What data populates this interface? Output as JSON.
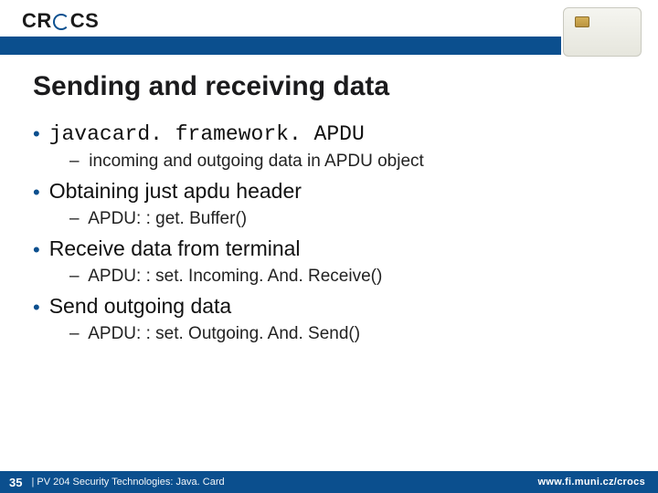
{
  "header": {
    "logo_text_left": "CR",
    "logo_text_right": "CS"
  },
  "slide": {
    "title": "Sending and receiving data",
    "b1_text": "javacard. framework. APDU",
    "b1_sub": "incoming and outgoing data in APDU object",
    "b2_text": "Obtaining just apdu header",
    "b2_sub": "APDU: : get. Buffer()",
    "b3_text": "Receive data from terminal",
    "b3_sub": "APDU: : set. Incoming. And. Receive()",
    "b4_text": "Send outgoing data",
    "b4_sub": "APDU: : set. Outgoing. And. Send()"
  },
  "footer": {
    "page": "35",
    "course": "| PV 204 Security Technologies: Java. Card",
    "url": "www.fi.muni.cz/crocs"
  }
}
